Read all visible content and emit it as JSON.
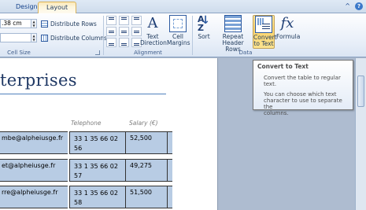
{
  "tabs": [
    {
      "label": "Design"
    },
    {
      "label": "Layout",
      "active": true
    }
  ],
  "window_controls": {
    "caret": "^",
    "help": "?"
  },
  "ribbon": {
    "cell_size": {
      "width_value": ".38 cm",
      "distribute_rows": "Distribute Rows",
      "distribute_columns": "Distribute Columns",
      "group_label": "Cell Size"
    },
    "alignment": {
      "text_direction": "Text Direction",
      "cell_margins": "Cell Margins",
      "group_label": "Alignment"
    },
    "data": {
      "sort": "Sort",
      "repeat_header_rows": "Repeat Header Rows",
      "convert_to_text": "Convert to Text",
      "formula": "Formula",
      "group_label": "Data"
    }
  },
  "document": {
    "title_fragment": "terprises",
    "columns": [
      "Telephone",
      "Salary (€)"
    ],
    "rows": [
      {
        "email": "mbe@alpheiusge.fr",
        "phone_line1": "33 1 35 66 02",
        "phone_line2": "56",
        "salary": "52,500"
      },
      {
        "email": "et@alpheiusge.fr",
        "phone_line1": "33 1 35 66 02",
        "phone_line2": "57",
        "salary": "49,275"
      },
      {
        "email": "rre@alpheiusge.fr",
        "phone_line1": "33 1 35 66 02",
        "phone_line2": "58",
        "salary": "51,500"
      }
    ]
  },
  "tooltip": {
    "title": "Convert to Text",
    "line1": "Convert the table to regular text.",
    "line2": "You can choose which text",
    "line3": "character to use to separate the",
    "line4": "columns."
  },
  "colors": {
    "accent": "#fdd56e",
    "table_fill": "#b8cce4",
    "title": "#1f3864"
  }
}
